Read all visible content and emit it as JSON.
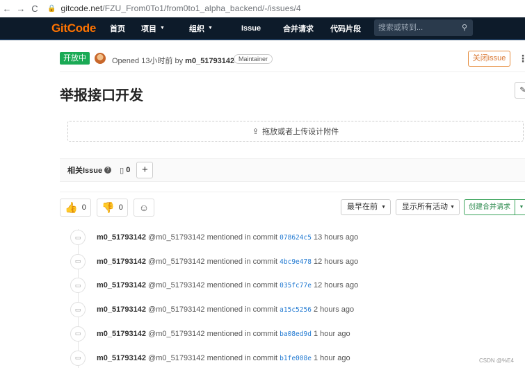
{
  "browser": {
    "back": "←",
    "forward": "→",
    "reload": "C",
    "url_host": "gitcode.net",
    "url_path": "/FZU_From0To1/from0to1_alpha_backend/-/issues/4"
  },
  "navbar": {
    "logo": "GitCode",
    "items": [
      {
        "label": "首页",
        "caret": false
      },
      {
        "label": "项目",
        "caret": true
      },
      {
        "label": "组织",
        "caret": true
      },
      {
        "label": "Issue",
        "caret": false
      },
      {
        "label": "合并请求",
        "caret": false
      },
      {
        "label": "代码片段",
        "caret": false
      }
    ],
    "search_placeholder": "搜索或转到..."
  },
  "issue": {
    "status": "开放中",
    "opened": "Opened 13小时前 by ",
    "author": "m0_51793142",
    "role": "Maintainer",
    "close_label": "关闭issue",
    "title": "举报接口开发",
    "upload_label": "拖放或者上传设计附件",
    "related_label": "相关Issue",
    "related_count": "0",
    "reactions": {
      "thumbs_up": "0",
      "thumbs_down": "0"
    },
    "sort_label": "最早在前",
    "filter_label": "显示所有活动",
    "create_mr_label": "创建合并请求"
  },
  "timeline": [
    {
      "user": "m0_51793142",
      "handle": "@m0_51793142",
      "action": "mentioned in commit",
      "sha": "078624c5",
      "time": "13 hours ago"
    },
    {
      "user": "m0_51793142",
      "handle": "@m0_51793142",
      "action": "mentioned in commit",
      "sha": "4bc9e478",
      "time": "12 hours ago"
    },
    {
      "user": "m0_51793142",
      "handle": "@m0_51793142",
      "action": "mentioned in commit",
      "sha": "035fc77e",
      "time": "12 hours ago"
    },
    {
      "user": "m0_51793142",
      "handle": "@m0_51793142",
      "action": "mentioned in commit",
      "sha": "a15c5256",
      "time": "2 hours ago"
    },
    {
      "user": "m0_51793142",
      "handle": "@m0_51793142",
      "action": "mentioned in commit",
      "sha": "ba08ed9d",
      "time": "1 hour ago"
    },
    {
      "user": "m0_51793142",
      "handle": "@m0_51793142",
      "action": "mentioned in commit",
      "sha": "b1fe008e",
      "time": "1 hour ago"
    }
  ],
  "watermark": "CSDN @%E4"
}
